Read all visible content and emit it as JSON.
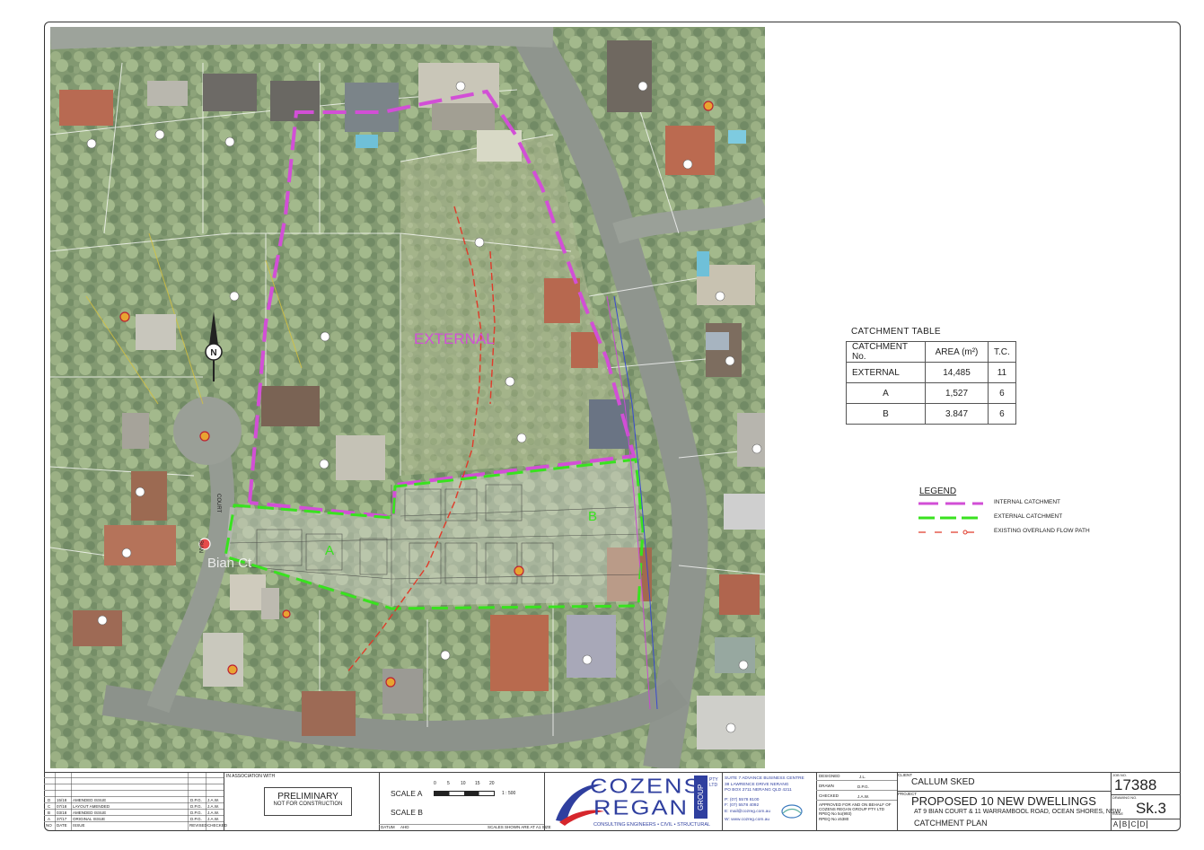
{
  "map": {
    "north_label": "N",
    "external_label": "EXTERNAL",
    "catchment_a_label": "A",
    "catchment_b_label": "B",
    "road_label_court": "COURT",
    "road_label_bian": "BIAN",
    "street_name_overlay": "Bian Ct"
  },
  "catchment_table": {
    "caption": "CATCHMENT TABLE",
    "headers": [
      "CATCHMENT No.",
      "AREA (m²)",
      "T.C."
    ],
    "rows": [
      [
        "EXTERNAL",
        "14,485",
        "11"
      ],
      [
        "A",
        "1,527",
        "6"
      ],
      [
        "B",
        "3.847",
        "6"
      ]
    ]
  },
  "legend": {
    "title": "LEGEND",
    "items": [
      {
        "label": "INTERNAL CATCHMENT",
        "color": "#d24fd6"
      },
      {
        "label": "EXTERNAL CATCHMENT",
        "color": "#39e21f"
      },
      {
        "label": "EXISTING OVERLAND FLOW PATH",
        "color": "#e03b2a"
      }
    ]
  },
  "title_block": {
    "revisions": [
      [
        "D",
        "15/18",
        "AMENDED ISSUE",
        "D.P.G.",
        "J.A.W."
      ],
      [
        "C",
        "07/18",
        "LAYOUT AMENDED",
        "D.P.G.",
        "J.A.W."
      ],
      [
        "B",
        "03/18",
        "AMENDED ISSUE",
        "D.P.G.",
        "J.A.W."
      ],
      [
        "A",
        "37/17",
        "ORIGINAL ISSUE",
        "D.P.G.",
        "J.A.W."
      ]
    ],
    "rev_headers": [
      "NO",
      "DATE",
      "ISSUE",
      "REVISED",
      "CHECKED"
    ],
    "in_association": "IN ASSOCIATION WITH",
    "preliminary": "PRELIMINARY",
    "not_for_construction": "NOT FOR CONSTRUCTION",
    "scale_a": "SCALE A",
    "scale_b": "SCALE B",
    "scale_ticks": [
      "0",
      "5",
      "10",
      "15",
      "20"
    ],
    "scale_ratio": "1 : 500",
    "datum": "DATUM",
    "datum_value": "AHD",
    "scales_note": "SCALES SHOWN ARE AT A1 SIZE",
    "company_top": "COZENS",
    "company_bottom": "REGAN",
    "company_group": "GROUP",
    "company_pty": "PTY LTD",
    "company_tagline": "CONSULTING ENGINEERS • CIVIL • STRUCTURAL",
    "address_lines": [
      "SUITE 7 ADVANCE BUSINESS CENTRE",
      "38 LAWRENCE DRIVE  NERANG",
      "PO BOX 2711  NERANG  QLD 4211",
      "P: (07) 5578 8100",
      "F: (07) 5578 4092",
      "E: mail@cozreg.com.au",
      "W: www.cozreg.com.au"
    ],
    "designed_label": "DESIGNED",
    "designed_value": "J.L.",
    "drawn_label": "DRAWN",
    "drawn_value": "D.P.G.",
    "checked_label": "CHECKED",
    "checked_value": "J.A.W.",
    "approval_lines": [
      "APPROVED FOR AND ON BEHALF OF",
      "COZENS REGAN GROUP PTY LTD",
      "RPEQ No 5o(993)",
      "RPEQ No x5380"
    ],
    "client_label": "CLIENT",
    "client_value": "CALLUM SKED",
    "project_label": "PROJECT",
    "project_title": "PROPOSED 10 NEW DWELLINGS",
    "project_address": "AT 9 BIAN COURT & 11 WARRAMBOOL ROAD, OCEAN SHORES, NSW",
    "drawing_title": "CATCHMENT PLAN",
    "job_label": "JOB NO.",
    "job_no": "17388",
    "drawing_no_label": "DRAWING NO.",
    "issue_label": "ISSUE",
    "drawing_no": "Sk.3",
    "issue_letters": [
      "A",
      "B",
      "C",
      "D"
    ]
  }
}
